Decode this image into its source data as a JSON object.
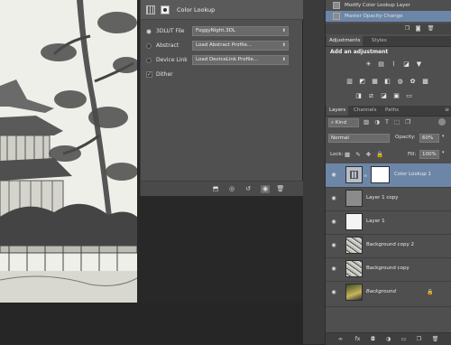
{
  "properties": {
    "title": "Color Lookup",
    "rows": [
      {
        "label": "3DLUT File",
        "value": "FoggyNight.3DL",
        "selected": true
      },
      {
        "label": "Abstract",
        "value": "Load Abstract Profile...",
        "selected": false
      },
      {
        "label": "Device Link",
        "value": "Load DeviceLink Profile...",
        "selected": false
      }
    ],
    "dither_label": "Dither",
    "dither_checked": true
  },
  "history": {
    "items": [
      {
        "label": "Modify Color Lookup Layer",
        "selected": false
      },
      {
        "label": "Master Opacity Change",
        "selected": true
      }
    ]
  },
  "adjustments": {
    "tabs": [
      "Adjustments",
      "Styles"
    ],
    "active_tab": "Adjustments",
    "heading": "Add an adjustment"
  },
  "layers": {
    "tabs": [
      "Layers",
      "Channels",
      "Paths"
    ],
    "active_tab": "Layers",
    "filter": "Kind",
    "blend_mode": "Normal",
    "opacity_label": "Opacity:",
    "opacity_value": "60%",
    "lock_label": "Lock:",
    "fill_label": "Fill:",
    "fill_value": "100%",
    "items": [
      {
        "name": "Color Lookup 1",
        "selected": true
      },
      {
        "name": "Layer 1 copy",
        "selected": false
      },
      {
        "name": "Layer 1",
        "selected": false
      },
      {
        "name": "Background copy 2",
        "selected": false
      },
      {
        "name": "Background copy",
        "selected": false
      },
      {
        "name": "Background",
        "selected": false,
        "italic": true,
        "locked": true
      }
    ]
  },
  "colors": {
    "selection": "#6c86a8",
    "panel": "#4f4f4f",
    "canvas": "#efefe9"
  }
}
